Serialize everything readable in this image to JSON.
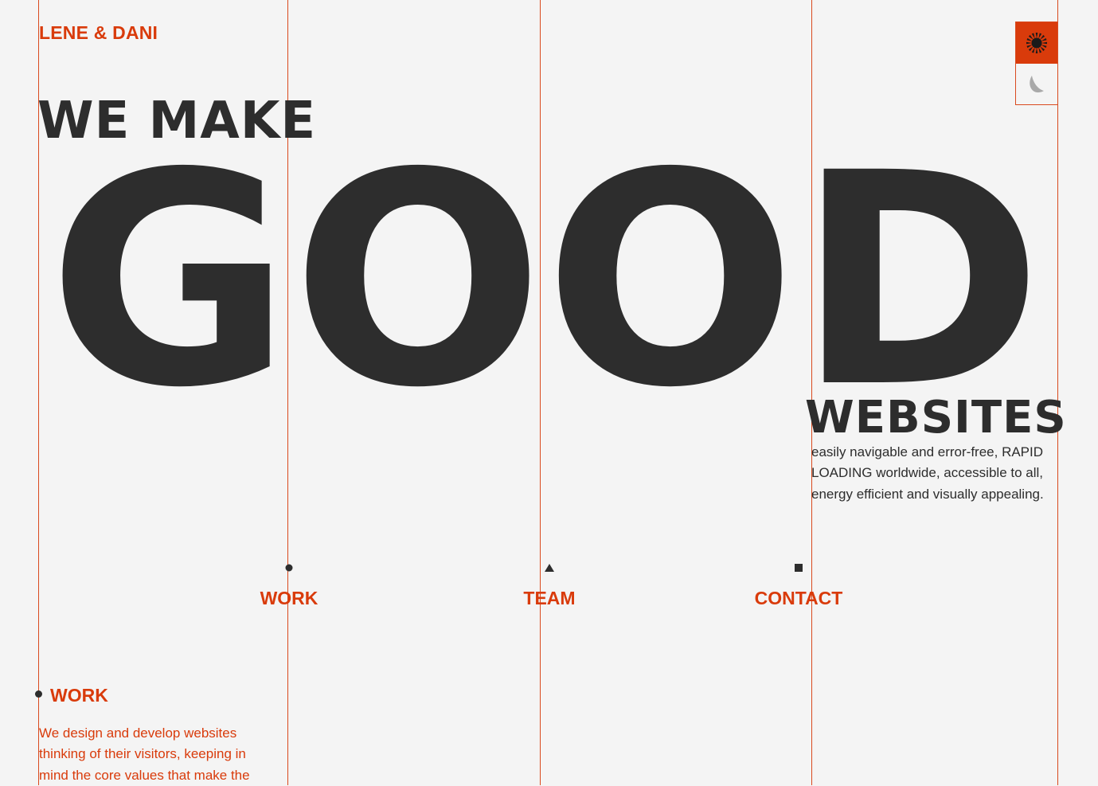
{
  "brand": {
    "name": "LENE & DANI"
  },
  "theme_toggle": {
    "light_icon": "sun-icon",
    "dark_icon": "moon-icon",
    "active": "light"
  },
  "hero": {
    "line1": "WE MAKE",
    "big_word": "GOOD",
    "line3": "WEBSITES",
    "tagline": "easily navigable and error-free, RAPID LOADING worldwide, accessible to all, energy efficient and visually appealing."
  },
  "nav": {
    "items": [
      {
        "label": "WORK",
        "marker": "circle-icon"
      },
      {
        "label": "TEAM",
        "marker": "triangle-icon"
      },
      {
        "label": "CONTACT",
        "marker": "square-icon"
      }
    ]
  },
  "work_section": {
    "title": "WORK",
    "marker": "circle-icon",
    "description": "We design and develop websites thinking of their visitors, keeping in mind the core values that make the"
  },
  "colors": {
    "background": "#f4f4f4",
    "text": "#2d2d2d",
    "accent": "#d93b0b",
    "grid_line": "#d94a1e"
  }
}
